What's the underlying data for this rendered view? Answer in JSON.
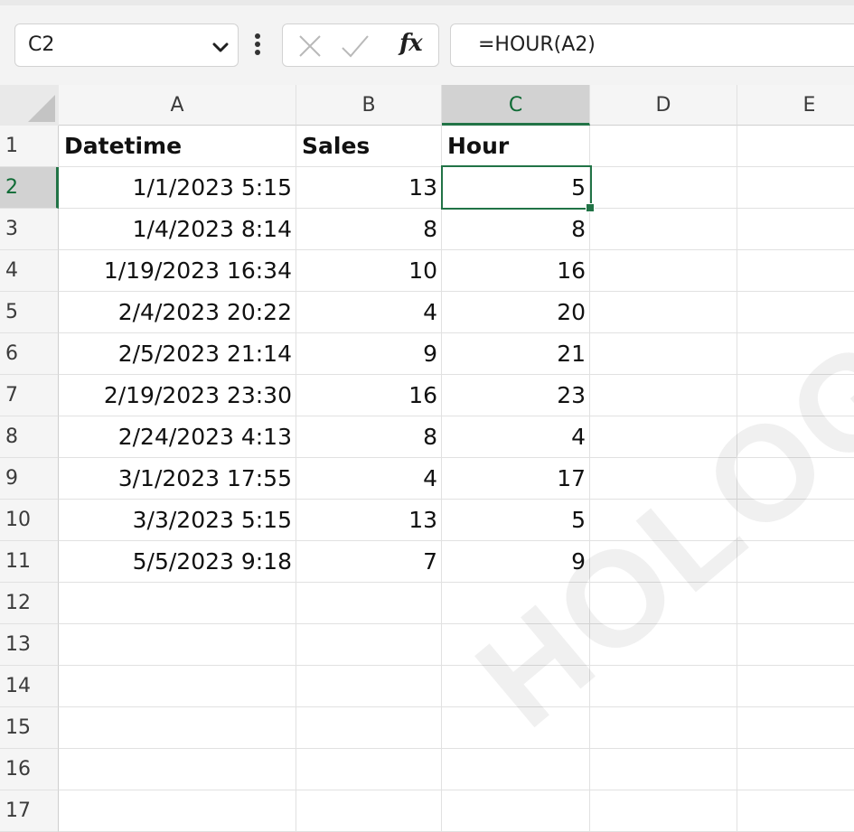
{
  "formula_bar": {
    "name_box": "C2",
    "formula": "=HOUR(A2)",
    "fx": "fx"
  },
  "icons": {
    "dropdown": "chevron-down-icon",
    "more": "vertical-dots-icon",
    "cancel": "cancel-x-icon",
    "enter": "checkmark-icon",
    "function": "fx-icon"
  },
  "colors": {
    "accent": "#217346",
    "selected_header": "#d2d2d2",
    "gridline": "#e1e1e1"
  },
  "columns": [
    "A",
    "B",
    "C",
    "D",
    "E"
  ],
  "row_numbers": [
    "1",
    "2",
    "3",
    "4",
    "5",
    "6",
    "7",
    "8",
    "9",
    "10",
    "11",
    "12",
    "13",
    "14",
    "15",
    "16",
    "17"
  ],
  "headers": {
    "a": "Datetime",
    "b": "Sales",
    "c": "Hour"
  },
  "rows": [
    {
      "datetime": "1/1/2023 5:15",
      "sales": "13",
      "hour": "5"
    },
    {
      "datetime": "1/4/2023 8:14",
      "sales": "8",
      "hour": "8"
    },
    {
      "datetime": "1/19/2023 16:34",
      "sales": "10",
      "hour": "16"
    },
    {
      "datetime": "2/4/2023 20:22",
      "sales": "4",
      "hour": "20"
    },
    {
      "datetime": "2/5/2023 21:14",
      "sales": "9",
      "hour": "21"
    },
    {
      "datetime": "2/19/2023 23:30",
      "sales": "16",
      "hour": "23"
    },
    {
      "datetime": "2/24/2023 4:13",
      "sales": "8",
      "hour": "4"
    },
    {
      "datetime": "3/1/2023 17:55",
      "sales": "4",
      "hour": "17"
    },
    {
      "datetime": "3/3/2023 5:15",
      "sales": "13",
      "hour": "5"
    },
    {
      "datetime": "5/5/2023 9:18",
      "sales": "7",
      "hour": "9"
    }
  ],
  "watermark": "HOLOGY"
}
